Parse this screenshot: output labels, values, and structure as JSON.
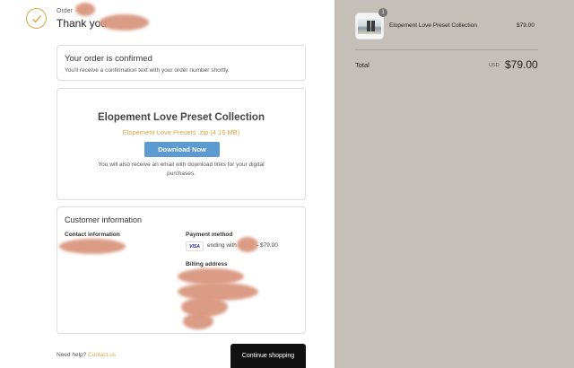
{
  "header": {
    "order_label": "Order",
    "thank_you": "Thank you"
  },
  "confirmed": {
    "heading": "Your order is confirmed",
    "text": "You'll receive a confirmation text with your order number shortly."
  },
  "download": {
    "product_title": "Elopement Love Preset Collection",
    "file": "Elopement Love Presets .zip (4.16 MB)",
    "button": "Download Now",
    "note": "You will also receive an email with download links for your digital purchases."
  },
  "customer": {
    "heading": "Customer information",
    "contact_label": "Contact information",
    "payment_label": "Payment method",
    "card_brand": "VISA",
    "ending_text": "ending with",
    "payment_amount": "- $79.00",
    "billing_label": "Billing address"
  },
  "footer": {
    "help_text": "Need help?",
    "contact_link": "Contact us",
    "continue_button": "Continue shopping"
  },
  "summary": {
    "quantity": "1",
    "product_name": "Elopement Love Preset Collection",
    "product_price": "$79.00",
    "total_label": "Total",
    "currency": "USD",
    "total_amount": "$79.00"
  },
  "colors": {
    "accent": "#d9a64a",
    "button_blue": "#5b9bd1",
    "sidebar_bg": "#c5bfba"
  }
}
